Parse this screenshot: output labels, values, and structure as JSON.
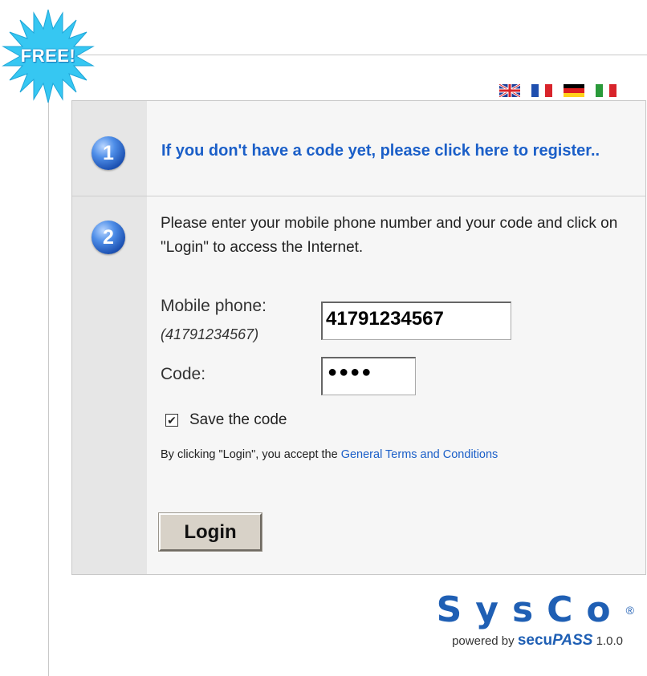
{
  "badge": {
    "text": "FREE!"
  },
  "flags": [
    {
      "lang": "english"
    },
    {
      "lang": "french",
      "colors": [
        "#1f4faf",
        "#ffffff",
        "#d8242b"
      ]
    },
    {
      "lang": "german",
      "colors": [
        "#000000",
        "#dd1e1e",
        "#ffd21a"
      ]
    },
    {
      "lang": "italian",
      "colors": [
        "#2a9a3a",
        "#ffffff",
        "#d8242b"
      ]
    }
  ],
  "step1": {
    "number": "1",
    "link_text": "If you don't have a code yet, please click here to register.."
  },
  "step2": {
    "number": "2",
    "instructions": "Please enter your mobile phone number and your code and click on \"Login\" to access the Internet.",
    "mobile_label": "Mobile phone:",
    "mobile_hint": "(41791234567)",
    "mobile_value": "41791234567",
    "code_label": "Code:",
    "code_value": "●●●●",
    "save_label": "Save the code",
    "save_checked": true,
    "terms_prefix": "By clicking \"Login\", you accept the ",
    "terms_link": "General Terms and Conditions",
    "login_label": "Login"
  },
  "footer": {
    "logo": "SysCo",
    "registered": "®",
    "powered_by": "powered by ",
    "secu": "secu",
    "pass": "PASS",
    "version": " 1.0.0"
  },
  "colors": {
    "link": "#1b5fc8",
    "brand": "#1f5fb4"
  }
}
